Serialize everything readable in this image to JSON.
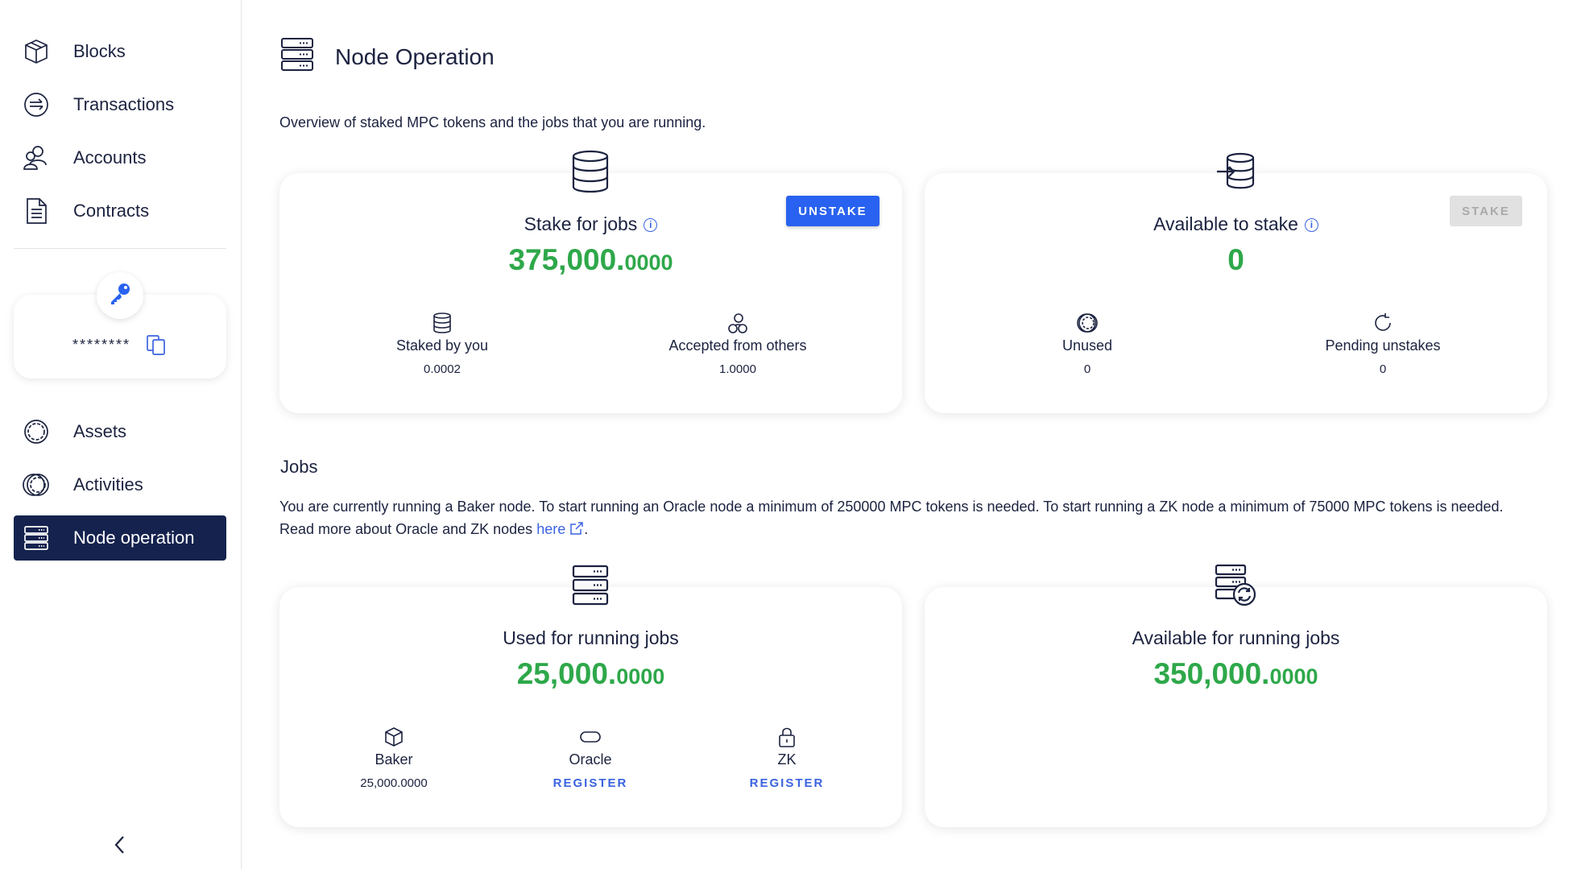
{
  "sidebar": {
    "items_top": [
      {
        "label": "Blocks",
        "icon": "cube-icon"
      },
      {
        "label": "Transactions",
        "icon": "transfer-icon"
      },
      {
        "label": "Accounts",
        "icon": "accounts-icon"
      },
      {
        "label": "Contracts",
        "icon": "document-icon"
      }
    ],
    "key_masked": "********",
    "items_bottom": [
      {
        "label": "Assets",
        "icon": "coin-icon"
      },
      {
        "label": "Activities",
        "icon": "coins-icon"
      },
      {
        "label": "Node operation",
        "icon": "server-icon",
        "active": true
      }
    ]
  },
  "page": {
    "title": "Node Operation",
    "subtitle": "Overview of staked MPC tokens and the jobs that you are running."
  },
  "stake_card": {
    "title": "Stake for jobs",
    "value_int": "375,000.",
    "value_dec": "0000",
    "unstake_label": "UNSTAKE",
    "staked_by_you_label": "Staked by you",
    "staked_by_you_value": "0.0002",
    "accepted_label": "Accepted from others",
    "accepted_value": "1.0000"
  },
  "available_card": {
    "title": "Available to stake",
    "value": "0",
    "stake_label": "STAKE",
    "unused_label": "Unused",
    "unused_value": "0",
    "pending_label": "Pending unstakes",
    "pending_value": "0"
  },
  "jobs": {
    "heading": "Jobs",
    "text_before_link": "You are currently running a Baker node. To start running an Oracle node a minimum of 250000 MPC tokens is needed. To start running a ZK node a minimum of 75000 MPC tokens is needed. Read more about Oracle and ZK nodes ",
    "link_label": "here",
    "text_after_link": "."
  },
  "used_card": {
    "title": "Used for running jobs",
    "value_int": "25,000.",
    "value_dec": "0000",
    "baker_label": "Baker",
    "baker_value": "25,000.0000",
    "oracle_label": "Oracle",
    "oracle_action": "REGISTER",
    "zk_label": "ZK",
    "zk_action": "REGISTER"
  },
  "available_jobs_card": {
    "title": "Available for running jobs",
    "value_int": "350,000.",
    "value_dec": "0000"
  },
  "colors": {
    "navy": "#15224e",
    "accent_blue": "#2962f0",
    "value_green": "#2ea84a"
  }
}
